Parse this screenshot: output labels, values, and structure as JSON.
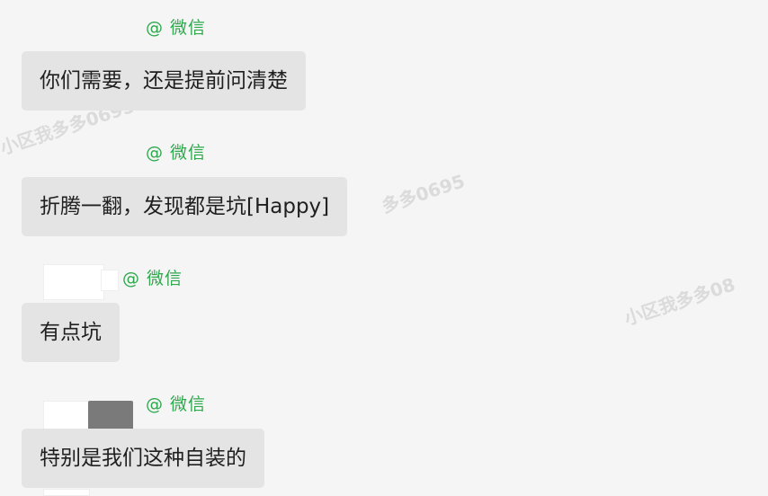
{
  "messages": [
    {
      "tag": "@ 微信",
      "text": "你们需要，还是提前问清楚"
    },
    {
      "tag": "@ 微信",
      "text": "折腾一翻，发现都是坑[Happy]"
    },
    {
      "tag": "@ 微信",
      "text": "有点坑"
    },
    {
      "tag": "@ 微信",
      "text": "特别是我们这种自装的"
    }
  ],
  "watermarks": [
    {
      "text": "小区我多多0695"
    },
    {
      "text": "多多0695"
    },
    {
      "text": "小区我多多08"
    }
  ],
  "colors": {
    "background": "#f5f5f5",
    "bubble": "#e4e4e4",
    "tag": "#2ea84d"
  }
}
